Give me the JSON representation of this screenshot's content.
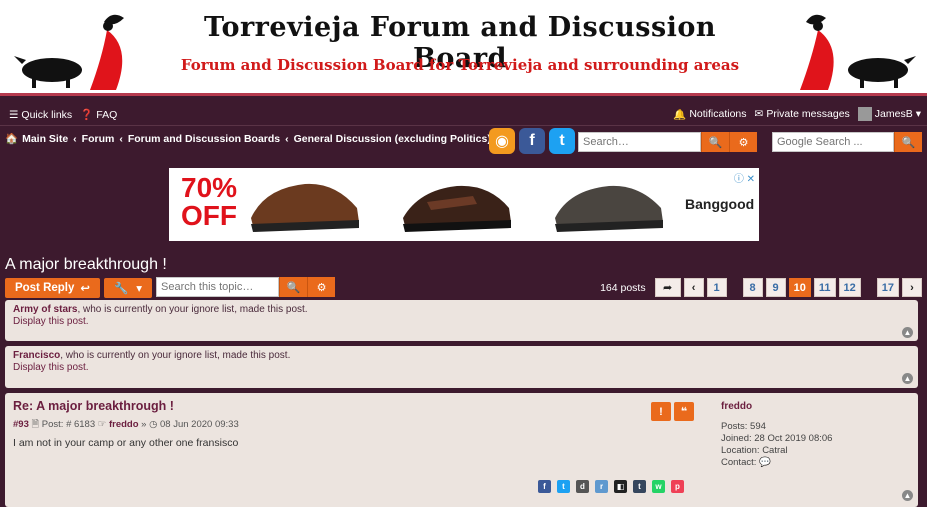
{
  "banner": {
    "title": "Torrevieja Forum and Discussion Board",
    "subtitle": "Forum and Discussion Board for Torrevieja and surrounding areas"
  },
  "navbar": {
    "quick_links": "Quick links",
    "faq": "FAQ",
    "notifications": "Notifications",
    "private_messages": "Private messages",
    "username": "JamesB"
  },
  "breadcrumb": {
    "items": [
      "Main Site",
      "Forum",
      "Forum and Discussion Boards",
      "General Discussion (excluding Politics)"
    ]
  },
  "search": {
    "placeholder": "Search…",
    "google_placeholder": "Google Search ..."
  },
  "ad": {
    "discount": "70%",
    "discount_sub": "OFF",
    "brand": "Banggood"
  },
  "topic": {
    "title": "A major breakthrough !",
    "post_reply_label": "Post Reply",
    "search_topic_placeholder": "Search this topic…",
    "post_count": "164 posts"
  },
  "pagination": {
    "pages": [
      "1",
      "8",
      "9",
      "10",
      "11",
      "12",
      "17"
    ],
    "current": "10"
  },
  "ignored_posts": [
    {
      "user": "Army of stars",
      "text": ", who is currently on your ignore list, made this post.",
      "link": "Display this post."
    },
    {
      "user": "Francisco",
      "text": ", who is currently on your ignore list, made this post.",
      "link": "Display this post."
    }
  ],
  "post": {
    "title": "Re: A major breakthrough !",
    "number": "#93",
    "post_label": "Post: # 6183",
    "author": "freddo",
    "date": "08 Jun 2020 09:33",
    "body": "I am not in your camp or any other one fransisco",
    "profile": {
      "username": "freddo",
      "posts": "Posts: 594",
      "joined": "Joined: 28 Oct 2019 08:06",
      "location": "Location: Catral",
      "contact": "Contact:"
    }
  },
  "colors": {
    "background": "#3d1a2e",
    "accent": "#ea6a1c",
    "link": "#6b1e3f"
  }
}
